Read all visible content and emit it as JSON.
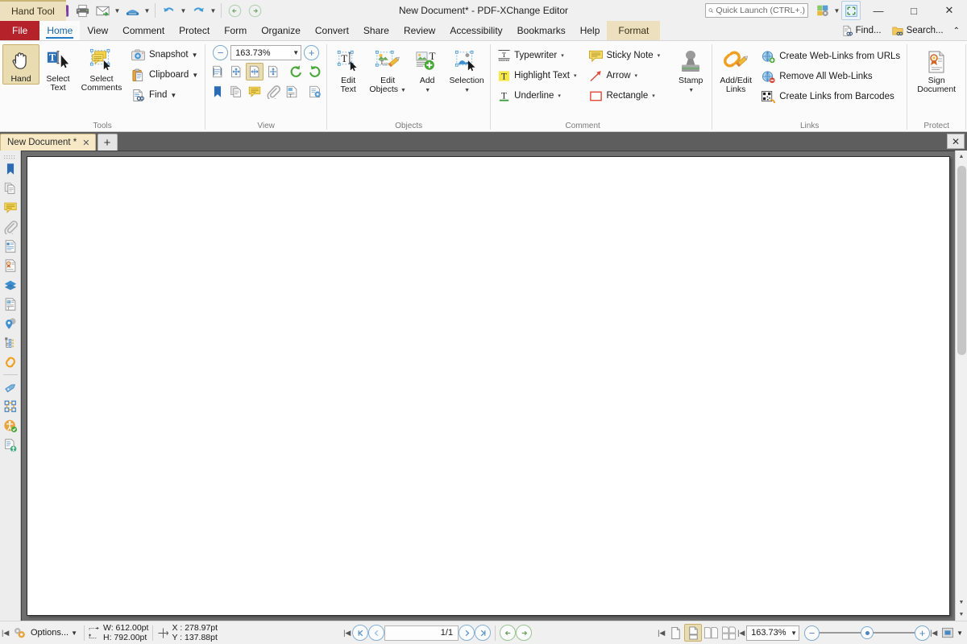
{
  "window": {
    "title": "New Document* - PDF-XChange Editor",
    "minimize_label": "—",
    "maximize_label": "□",
    "close_label": "✕"
  },
  "quick_access": {
    "items": [
      {
        "name": "app-logo-icon",
        "label": "PDF-XChange Editor"
      },
      {
        "name": "open-icon",
        "label": "Open"
      },
      {
        "name": "save-icon",
        "label": "Save"
      },
      {
        "name": "print-icon",
        "label": "Print"
      },
      {
        "name": "email-icon",
        "label": "Email"
      },
      {
        "name": "scan-icon",
        "label": "Scan"
      },
      {
        "name": "undo-icon",
        "label": "Undo"
      },
      {
        "name": "redo-icon",
        "label": "Redo"
      },
      {
        "name": "back-icon",
        "label": "Previous View"
      },
      {
        "name": "forward-icon",
        "label": "Next View"
      }
    ]
  },
  "search": {
    "quick_launch_placeholder": "Quick Launch (CTRL+.)"
  },
  "titlebar_tools": {
    "customize_label": "Customize",
    "fullscreen_label": "Full Screen"
  },
  "menubar": {
    "file_label": "File",
    "items": [
      {
        "label": "Home",
        "active": true
      },
      {
        "label": "View",
        "active": false
      },
      {
        "label": "Comment",
        "active": false
      },
      {
        "label": "Protect",
        "active": false
      },
      {
        "label": "Form",
        "active": false
      },
      {
        "label": "Organize",
        "active": false
      },
      {
        "label": "Convert",
        "active": false
      },
      {
        "label": "Share",
        "active": false
      },
      {
        "label": "Review",
        "active": false
      },
      {
        "label": "Accessibility",
        "active": false
      },
      {
        "label": "Bookmarks",
        "active": false
      },
      {
        "label": "Help",
        "active": false
      }
    ],
    "context_tab": {
      "header": "Hand Tool",
      "label": "Format"
    },
    "right": {
      "find_label": "Find...",
      "search_label": "Search...",
      "collapse_label": "⌃"
    }
  },
  "ribbon": {
    "groups": [
      {
        "name": "tools",
        "label": "Tools",
        "buttons": [
          {
            "label": "Hand",
            "icon": "hand-icon",
            "selected": true
          },
          {
            "label": "Select\nText",
            "line1": "Select",
            "line2": "Text",
            "icon": "select-text-icon",
            "selected": false
          },
          {
            "label": "Select\nComments",
            "line1": "Select",
            "line2": "Comments",
            "icon": "select-comments-icon",
            "selected": false
          }
        ],
        "small_buttons": [
          {
            "label": "Snapshot",
            "icon": "snapshot-icon",
            "has_dropdown": true
          },
          {
            "label": "Clipboard",
            "icon": "clipboard-icon",
            "has_dropdown": true
          },
          {
            "label": "Find",
            "icon": "find-icon",
            "has_dropdown": true
          }
        ]
      },
      {
        "name": "view",
        "label": "View",
        "zoom_value": "163.73%",
        "zoom_out_label": "−",
        "zoom_in_label": "+",
        "row1_icons": [
          {
            "name": "actual-size-icon",
            "selected": false
          },
          {
            "name": "fit-page-icon",
            "selected": false
          },
          {
            "name": "fit-width-icon",
            "selected": true
          },
          {
            "name": "fit-visible-icon",
            "selected": false
          },
          {
            "name": "rotate-left-icon",
            "selected": false
          },
          {
            "name": "rotate-right-icon",
            "selected": false
          }
        ],
        "row2_icons": [
          {
            "name": "bookmarks-panel-icon",
            "selected": false
          },
          {
            "name": "thumbnails-panel-icon",
            "selected": false
          },
          {
            "name": "comments-panel-icon",
            "selected": false
          },
          {
            "name": "attachments-panel-icon",
            "selected": false
          },
          {
            "name": "content-panel-icon",
            "selected": false
          },
          {
            "name": "properties-panel-icon",
            "selected": false
          }
        ]
      },
      {
        "name": "objects",
        "label": "Objects",
        "buttons": [
          {
            "line1": "Edit",
            "line2": "Text",
            "icon": "edit-text-icon",
            "has_dropdown": false
          },
          {
            "line1": "Edit",
            "line2": "Objects",
            "icon": "edit-objects-icon",
            "has_dropdown": true
          },
          {
            "line1": "Add",
            "line2": "",
            "icon": "add-object-icon",
            "has_dropdown": true
          },
          {
            "line1": "Selection",
            "line2": "",
            "icon": "selection-icon",
            "has_dropdown": true
          }
        ]
      },
      {
        "name": "comment",
        "label": "Comment",
        "items": [
          {
            "label": "Typewriter",
            "icon": "typewriter-icon",
            "has_dropdown": true
          },
          {
            "label": "Sticky Note",
            "icon": "sticky-note-icon",
            "has_dropdown": true
          },
          {
            "label": "Highlight Text",
            "icon": "highlight-text-icon",
            "has_dropdown": true
          },
          {
            "label": "Arrow",
            "icon": "arrow-icon",
            "has_dropdown": true
          },
          {
            "label": "Underline",
            "icon": "underline-icon",
            "has_dropdown": true
          },
          {
            "label": "Rectangle",
            "icon": "rectangle-icon",
            "has_dropdown": true
          }
        ],
        "stamp": {
          "label": "Stamp",
          "icon": "stamp-icon",
          "has_dropdown": true
        }
      },
      {
        "name": "links",
        "label": "Links",
        "big_button": {
          "line1": "Add/Edit",
          "line2": "Links",
          "icon": "add-edit-links-icon"
        },
        "items": [
          {
            "label": "Create Web-Links from URLs",
            "icon": "create-web-links-icon"
          },
          {
            "label": "Remove All Web-Links",
            "icon": "remove-web-links-icon"
          },
          {
            "label": "Create Links from Barcodes",
            "icon": "barcode-links-icon"
          }
        ]
      },
      {
        "name": "protect",
        "label": "Protect",
        "big_button": {
          "line1": "Sign",
          "line2": "Document",
          "icon": "sign-document-icon"
        }
      }
    ]
  },
  "doctabs": {
    "tabs": [
      {
        "label": "New Document *",
        "close_label": "✕",
        "active": true
      }
    ],
    "add_label": "+",
    "close_all_label": "✕"
  },
  "panels": {
    "items": [
      {
        "name": "bookmarks-panel-icon",
        "label": "Bookmarks"
      },
      {
        "name": "thumbnails-panel-icon",
        "label": "Thumbnails"
      },
      {
        "name": "comments-panel-icon",
        "label": "Comments"
      },
      {
        "name": "attachments-panel-icon",
        "label": "Attachments"
      },
      {
        "name": "fields-panel-icon",
        "label": "Fields"
      },
      {
        "name": "signatures-panel-icon",
        "label": "Signatures"
      },
      {
        "name": "layers-panel-icon",
        "label": "Layers"
      },
      {
        "name": "content-panel-icon",
        "label": "Content"
      },
      {
        "name": "destinations-panel-icon",
        "label": "Destinations"
      },
      {
        "name": "structure-panel-icon",
        "label": "Structure"
      },
      {
        "name": "links-panel-icon",
        "label": "Links"
      },
      {
        "name": "stamps-panel-icon",
        "label": "Stamps"
      },
      {
        "name": "tags-panel-icon",
        "label": "Tags"
      },
      {
        "name": "accessibility-panel-icon",
        "label": "Accessibility Check"
      },
      {
        "name": "reading-order-panel-icon",
        "label": "Reading Order"
      }
    ]
  },
  "statusbar": {
    "options_label": "Options...",
    "size": {
      "width": "W: 612.00pt",
      "height": "H: 792.00pt"
    },
    "cursor": {
      "x": "X : 278.97pt",
      "y": "Y : 137.88pt"
    },
    "nav": {
      "first_label": "⏮",
      "prev_label": "‹",
      "page_value": "1/1",
      "next_label": "›",
      "last_label": "⏭",
      "back_label": "←",
      "forward_label": "→"
    },
    "layout": [
      {
        "name": "single-page-icon",
        "selected": false
      },
      {
        "name": "single-page-continuous-icon",
        "selected": true
      },
      {
        "name": "two-pages-icon",
        "selected": false
      },
      {
        "name": "two-pages-continuous-icon",
        "selected": false
      }
    ],
    "zoom_value": "163.73%",
    "zoom_out_label": "−",
    "zoom_in_label": "+",
    "fullscreen_label": "Full Screen"
  },
  "colors": {
    "file_tab": "#b5222a",
    "accent": "#1e7bc4",
    "selected_tool": "#e8dcb0",
    "context_tab": "#ece0be",
    "viewport_bg": "#6e6e6e"
  }
}
